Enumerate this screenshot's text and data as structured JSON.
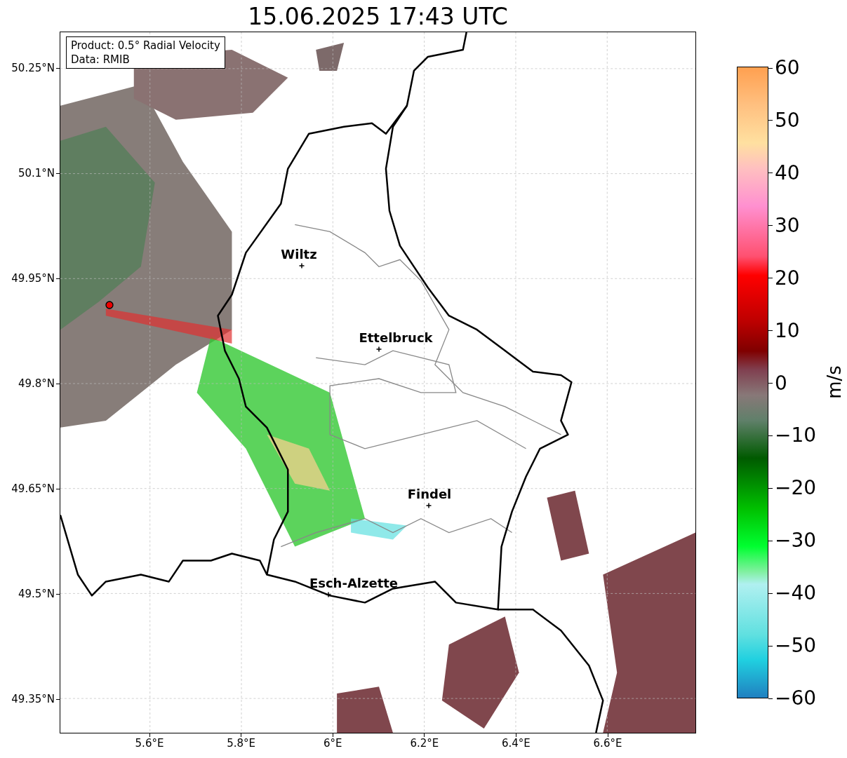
{
  "title": "15.06.2025 17:43 UTC",
  "legend": {
    "lines": [
      "Product: 0.5° Radial Velocity",
      "Data: RMIB"
    ]
  },
  "map": {
    "cities": [
      {
        "name": "Wiltz"
      },
      {
        "name": "Ettelbruck"
      },
      {
        "name": "Findel"
      },
      {
        "name": "Esch-Alzette"
      }
    ]
  },
  "y_ticks": [
    "50.25°N",
    "50.1°N",
    "49.95°N",
    "49.8°N",
    "49.65°N",
    "49.5°N",
    "49.35°N"
  ],
  "x_ticks": [
    "5.6°E",
    "5.8°E",
    "6°E",
    "6.2°E",
    "6.4°E",
    "6.6°E"
  ],
  "colorbar": {
    "label": "m/s",
    "ticks": [
      "60",
      "50",
      "40",
      "30",
      "20",
      "10",
      "0",
      "−10",
      "−20",
      "−30",
      "−40",
      "−50",
      "−60"
    ]
  }
}
